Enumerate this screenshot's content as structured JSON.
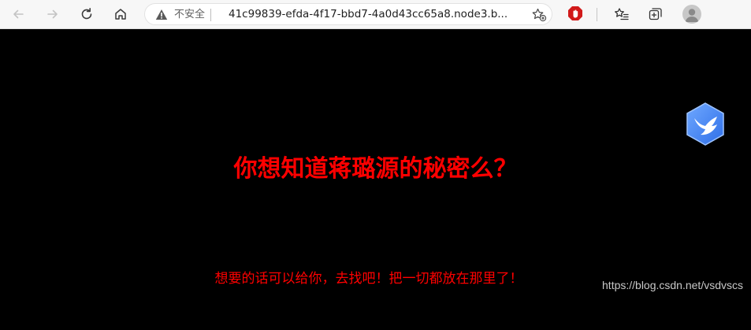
{
  "browser": {
    "security_label": "不安全",
    "url": "41c99839-efda-4f17-bbd7-4a0d43cc65a8.node3.b...",
    "icons": [
      "back-arrow-icon",
      "forward-arrow-icon",
      "refresh-icon",
      "home-icon",
      "warning-icon",
      "favorite-star-icon",
      "adblock-extension-icon",
      "favorites-list-icon",
      "collections-icon",
      "profile-avatar-icon"
    ]
  },
  "page": {
    "heading": "你想知道蒋璐源的秘密么？",
    "subtext": "想要的话可以给你，去找吧！把一切都放在那里了！",
    "text_color": "#ff0000",
    "background_color": "#000000",
    "badge_icon": "bird-icon"
  },
  "watermark": "https://blog.csdn.net/vsdvscs"
}
